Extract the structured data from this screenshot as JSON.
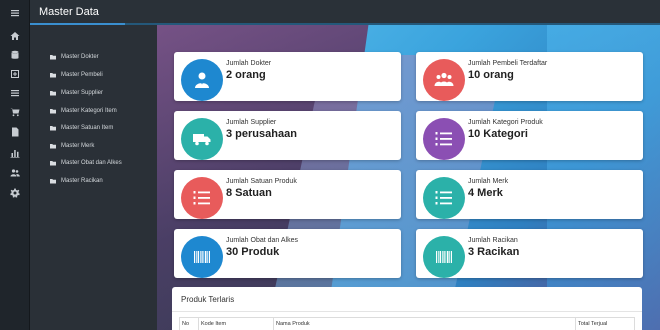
{
  "app": {
    "title": "Master Data"
  },
  "rail": {
    "items": [
      {
        "icon": "hamburger-menu-icon"
      },
      {
        "icon": "home-icon"
      },
      {
        "icon": "database-icon"
      },
      {
        "icon": "plus-square-icon"
      },
      {
        "icon": "list-icon"
      },
      {
        "icon": "shopping-cart-icon"
      },
      {
        "icon": "document-icon"
      },
      {
        "icon": "bar-chart-icon"
      },
      {
        "icon": "users-icon"
      },
      {
        "icon": "gear-icon"
      }
    ]
  },
  "submenu": {
    "items": [
      {
        "label": "Master Dokter"
      },
      {
        "label": "Master Pembeli"
      },
      {
        "label": "Master Supplier"
      },
      {
        "label": "Master Kategori Item"
      },
      {
        "label": "Master Satuan Item"
      },
      {
        "label": "Master Merk"
      },
      {
        "label": "Master Obat dan Alkes"
      },
      {
        "label": "Master Racikan"
      }
    ]
  },
  "cards": [
    {
      "label": "Jumlah Dokter",
      "value": "2 orang",
      "icon": "doctor-icon",
      "color": "#1e88d0"
    },
    {
      "label": "Jumlah Pembeli Terdaftar",
      "value": "10 orang",
      "icon": "users-icon",
      "color": "#e85b5b"
    },
    {
      "label": "Jumlah Supplier",
      "value": "3 perusahaan",
      "icon": "truck-icon",
      "color": "#2bb1a9"
    },
    {
      "label": "Jumlah Kategori Produk",
      "value": "10 Kategori",
      "icon": "numbered-list-icon",
      "color": "#8b4fb3"
    },
    {
      "label": "Jumlah Satuan Produk",
      "value": "8 Satuan",
      "icon": "numbered-list-icon",
      "color": "#e85b5b"
    },
    {
      "label": "Jumlah Merk",
      "value": "4 Merk",
      "icon": "numbered-list-icon",
      "color": "#2bb1a9"
    },
    {
      "label": "Jumlah Obat dan Alkes",
      "value": "30 Produk",
      "icon": "barcode-icon",
      "color": "#1e88d0"
    },
    {
      "label": "Jumlah Racikan",
      "value": "3 Racikan",
      "icon": "barcode-icon",
      "color": "#2bb1a9"
    }
  ],
  "table": {
    "title": "Produk Terlaris",
    "columns": [
      "No",
      "Kode Item",
      "Nama Produk",
      "Total Terjual"
    ]
  }
}
